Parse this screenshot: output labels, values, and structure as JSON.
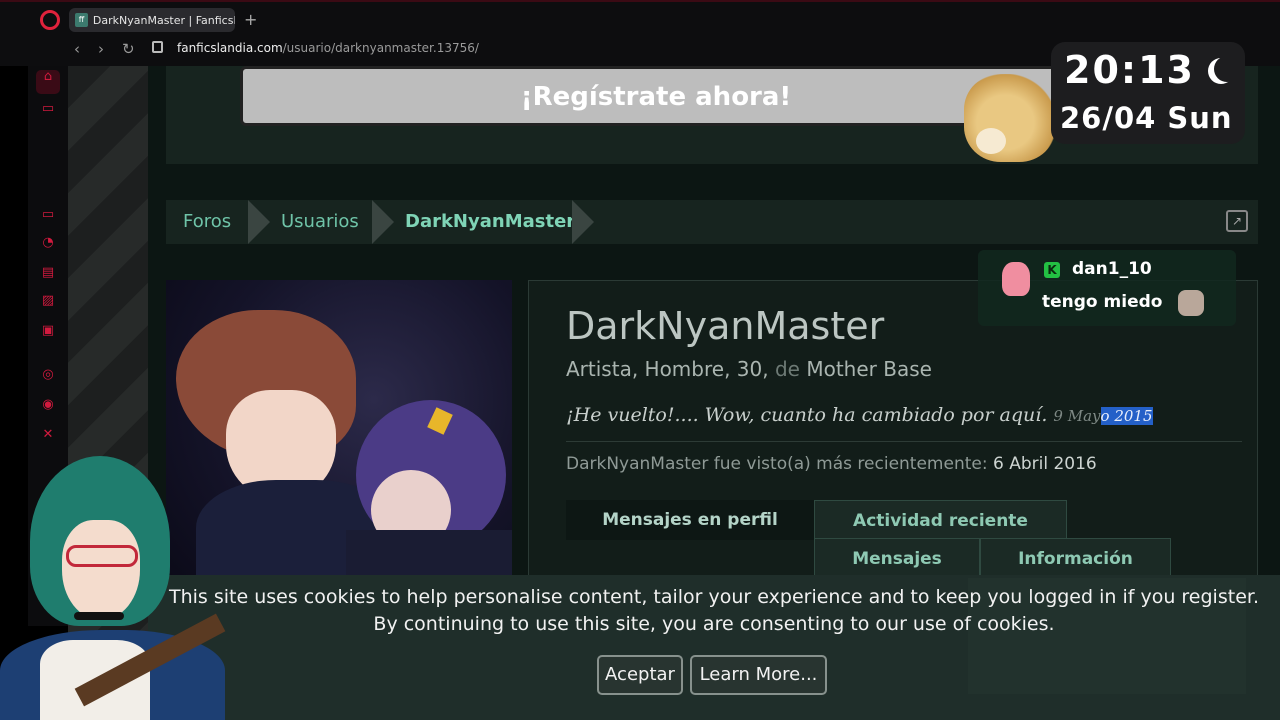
{
  "browser": {
    "tab_title": "DarkNyanMaster | Fanficsl...",
    "favicon_text": "ff",
    "new_tab": "+",
    "url_host": "fanficslandia.com",
    "url_path": "/usuario/darknyanmaster.13756/"
  },
  "page": {
    "register_label": "¡Regístrate ahora!",
    "breadcrumb": [
      "Foros",
      "Usuarios",
      "DarkNyanMaster"
    ],
    "profile": {
      "name": "DarkNyanMaster",
      "info_main": "Artista, Hombre, 30, ",
      "info_de": "de",
      "info_location": " Mother Base",
      "status": "¡He vuelto!.... Wow, cuanto ha cambiado por aquí.",
      "status_date_plain": "9 May",
      "status_date_selected": "o 2015",
      "seen_label": "DarkNyanMaster fue visto(a) más recientemente: ",
      "seen_value": "6 Abril 2016"
    },
    "tabs": [
      "Mensajes en perfil",
      "Actividad reciente",
      "Mensajes",
      "Información"
    ]
  },
  "cookie": {
    "line1": "This site uses cookies to help personalise content, tailor your experience and to keep you logged in if you register.",
    "line2": "By continuing to use this site, you are consenting to our use of cookies.",
    "accept": "Aceptar",
    "learn_more": "Learn More..."
  },
  "overlay": {
    "clock_time": "20:13",
    "clock_date": "26/04 Sun",
    "chat_badge": "K",
    "chat_user": "dan1_10",
    "chat_message": "tengo miedo"
  },
  "colors": {
    "accent_red": "#d21a3e",
    "link_green": "#6fc4a8",
    "selection_blue": "#2460c8"
  }
}
